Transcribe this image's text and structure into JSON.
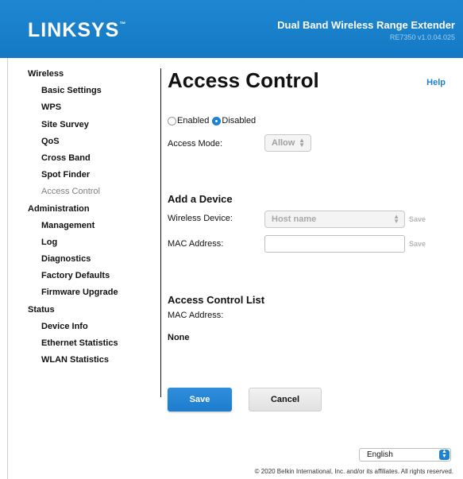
{
  "header": {
    "logo": "LINKSYS",
    "logo_mark": "™",
    "product": "Dual Band Wireless Range Extender",
    "version": "RE7350 v1.0.04.025"
  },
  "nav": {
    "items": [
      {
        "label": "Wireless",
        "level": 0
      },
      {
        "label": "Basic Settings",
        "level": 1
      },
      {
        "label": "WPS",
        "level": 1
      },
      {
        "label": "Site Survey",
        "level": 1
      },
      {
        "label": "QoS",
        "level": 1
      },
      {
        "label": "Cross Band",
        "level": 1
      },
      {
        "label": "Spot Finder",
        "level": 1
      },
      {
        "label": "Access Control",
        "level": 1,
        "active": true
      },
      {
        "label": "Administration",
        "level": 0
      },
      {
        "label": "Management",
        "level": 1
      },
      {
        "label": "Log",
        "level": 1
      },
      {
        "label": "Diagnostics",
        "level": 1
      },
      {
        "label": "Factory Defaults",
        "level": 1
      },
      {
        "label": "Firmware Upgrade",
        "level": 1
      },
      {
        "label": "Status",
        "level": 0
      },
      {
        "label": "Device Info",
        "level": 1
      },
      {
        "label": "Ethernet Statistics",
        "level": 1
      },
      {
        "label": "WLAN Statistics",
        "level": 1
      }
    ]
  },
  "main": {
    "title": "Access Control",
    "help": "Help",
    "enabled_label": "Enabled",
    "disabled_label": "Disabled",
    "access_mode_label": "Access Mode:",
    "access_mode_value": "Allow",
    "add_device_title": "Add a Device",
    "wireless_device_label": "Wireless Device:",
    "wireless_device_value": "Host name",
    "mac_address_label": "MAC Address:",
    "save_link": "Save",
    "list_title": "Access Control List",
    "list_mac_label": "MAC Address:",
    "list_value": "None",
    "save_button": "Save",
    "cancel_button": "Cancel"
  },
  "footer": {
    "language": "English",
    "copyright": "© 2020 Belkin International, Inc. and/or its affiliates. All rights reserved."
  },
  "colors": {
    "brand": "#1479c4",
    "accent": "#1c82d4"
  }
}
